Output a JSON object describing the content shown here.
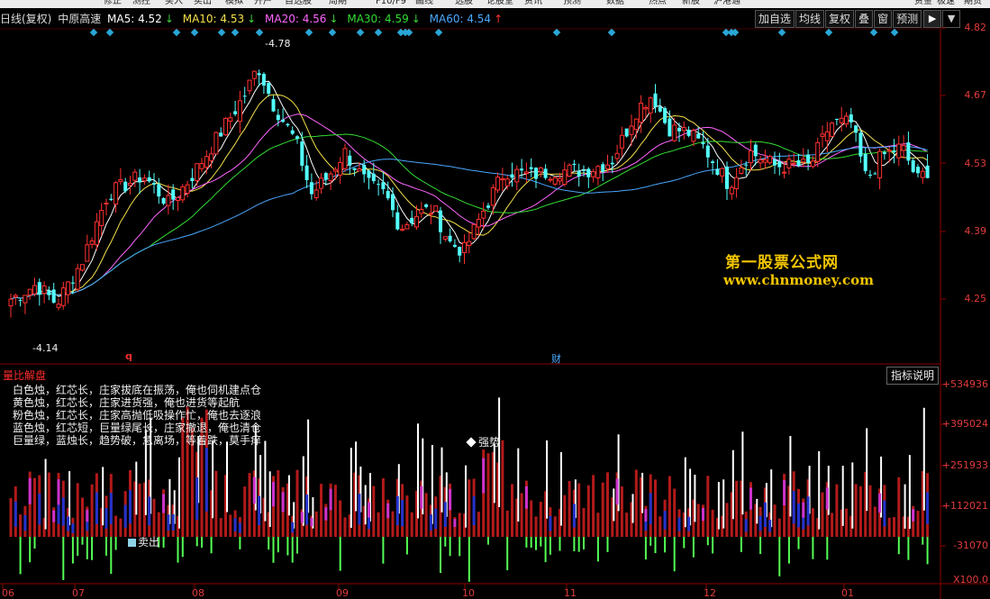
{
  "top_menu": [
    "修正",
    "测控",
    "买入",
    "卖出",
    "模拟",
    "开户",
    "自选股",
    "周期",
    "F10/F9",
    "画线",
    "选股",
    "论股堂",
    "资讯",
    "预测",
    "数据",
    "热点",
    "新股",
    "沪港通",
    "资金",
    "极速",
    "期货"
  ],
  "stock": {
    "chart_label": "日线(复权)",
    "name": "中原高速",
    "ma5": "MA5: 4.52",
    "ma10": "MA10: 4.53",
    "ma20": "MA20: 4.56",
    "ma30": "MA30: 4.59",
    "ma60": "MA60: 4.54",
    "ma5_arrow": "↓",
    "ma10_arrow": "↓",
    "ma20_arrow": "↓",
    "ma30_arrow": "↓",
    "ma60_arrow": "↑"
  },
  "toolbar": [
    "加自选",
    "均线",
    "复权",
    "叠",
    "窗",
    "预测"
  ],
  "toolbar_arrows": [
    "▶",
    "▼"
  ],
  "price_axis": {
    "labels": [
      "4.82",
      "4.67",
      "4.53",
      "4.39",
      "4.25"
    ]
  },
  "price_annotations": {
    "high": "4.78",
    "low": "4.14",
    "q_mark": "q",
    "cai_mark": "财"
  },
  "watermark": {
    "cn": "第一股票公式网",
    "url": "www.chnmoney.com"
  },
  "indicator": {
    "title": "量比解盘",
    "button": "指标说明",
    "legend": [
      "白色烛，红芯长，庄家拔底在振荡，俺也伺机建点仓",
      "黄色烛，红芯长，庄家进货强，俺也进货等起航",
      "粉色烛，红芯长，庄家高抛低吸操作忙，俺也去逐浪",
      "蓝色烛，红芯短，巨量绿尾长，庄家撤退，俺也清仓",
      "巨量绿，蓝烛长，趋势破，急离场，等着跌，莫手痒"
    ],
    "axis_labels": [
      "+534936",
      "+395024",
      "+251933",
      "+112021",
      "-31070",
      "X100.0"
    ],
    "signal_strong": "强势",
    "signal_sell": "卖出"
  },
  "x_axis": [
    "06",
    "07",
    "08",
    "09",
    "10",
    "11",
    "12",
    "01"
  ],
  "colors": {
    "up": "#ff3030",
    "down": "#54ffff",
    "ma5": "#ffffff",
    "ma10": "#f5e04a",
    "ma20": "#ff66ff",
    "ma30": "#33dd33",
    "ma60": "#4aa8ff",
    "axis": "#8b0000",
    "label": "#e23b3b"
  }
}
